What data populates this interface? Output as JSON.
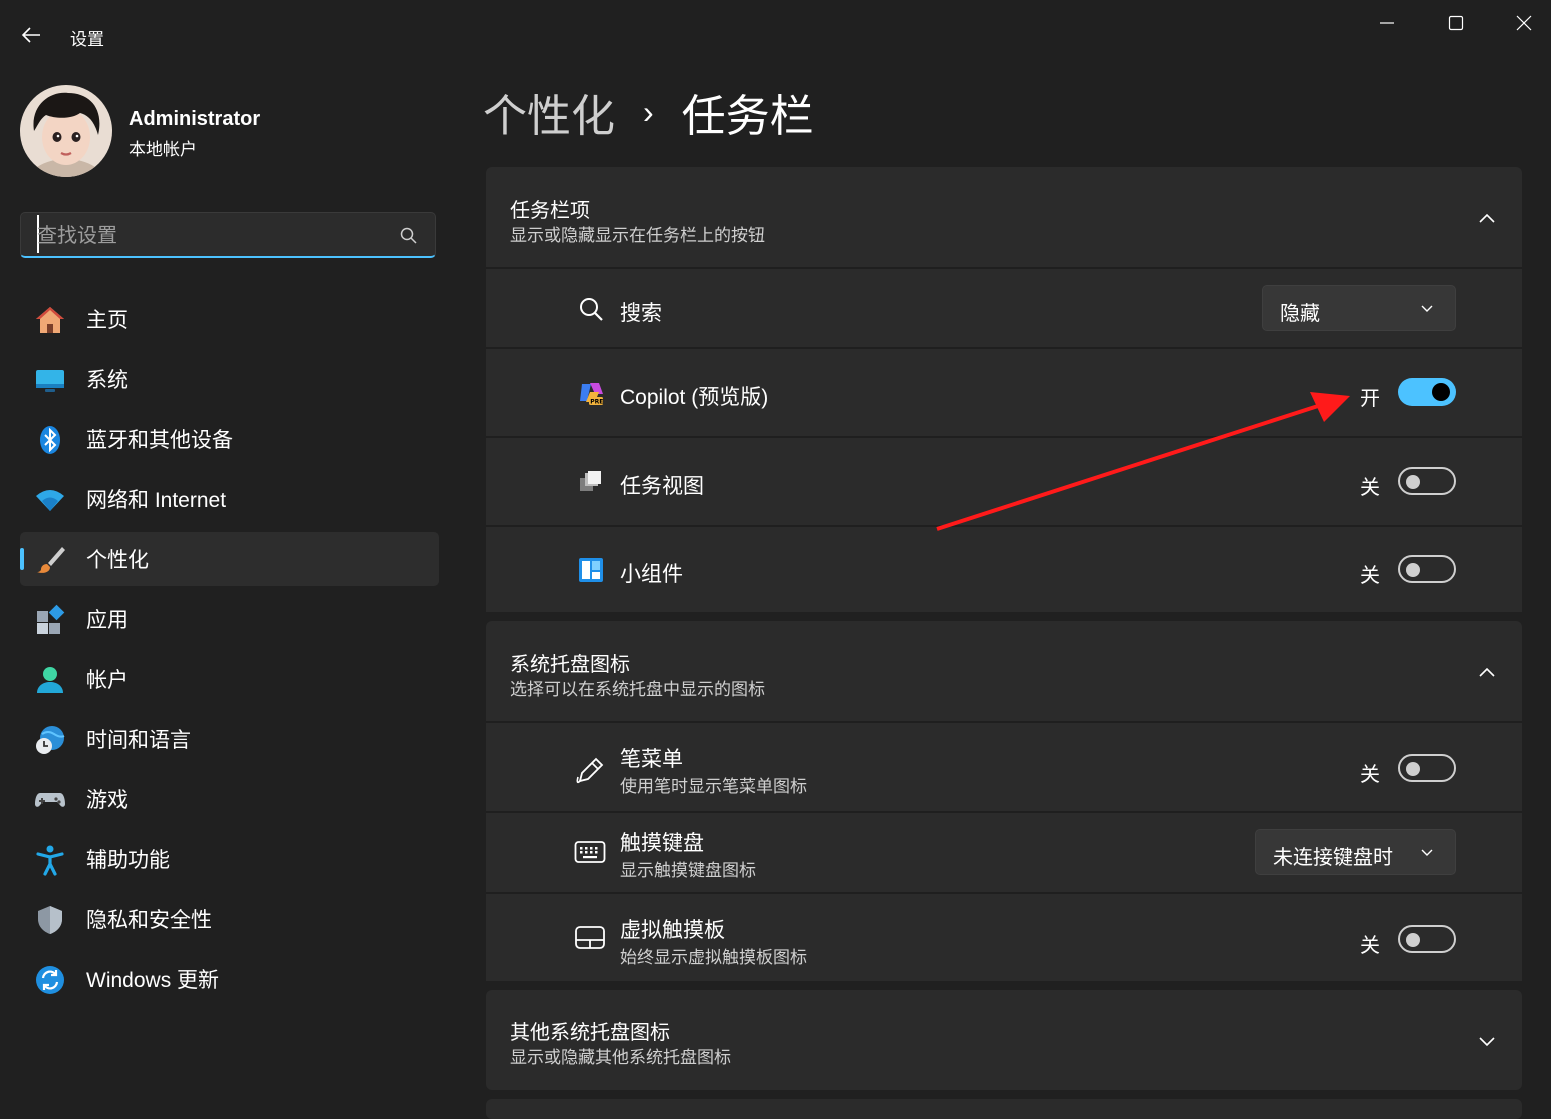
{
  "window": {
    "title": "设置",
    "controls": [
      "minimize",
      "maximize",
      "close"
    ]
  },
  "profile": {
    "name": "Administrator",
    "account_type": "本地帐户"
  },
  "search": {
    "placeholder": "查找设置",
    "value": ""
  },
  "nav": {
    "items": [
      {
        "label": "主页",
        "icon": "home-icon",
        "active": false
      },
      {
        "label": "系统",
        "icon": "monitor-icon",
        "active": false
      },
      {
        "label": "蓝牙和其他设备",
        "icon": "bluetooth-icon",
        "active": false
      },
      {
        "label": "网络和 Internet",
        "icon": "wifi-icon",
        "active": false
      },
      {
        "label": "个性化",
        "icon": "paintbrush-icon",
        "active": true
      },
      {
        "label": "应用",
        "icon": "apps-icon",
        "active": false
      },
      {
        "label": "帐户",
        "icon": "person-icon",
        "active": false
      },
      {
        "label": "时间和语言",
        "icon": "globe-clock-icon",
        "active": false
      },
      {
        "label": "游戏",
        "icon": "gamepad-icon",
        "active": false
      },
      {
        "label": "辅助功能",
        "icon": "accessibility-icon",
        "active": false
      },
      {
        "label": "隐私和安全性",
        "icon": "shield-icon",
        "active": false
      },
      {
        "label": "Windows 更新",
        "icon": "sync-icon",
        "active": false
      }
    ]
  },
  "breadcrumb": {
    "parent": "个性化",
    "separator": "›",
    "current": "任务栏"
  },
  "groups": {
    "taskbar_items": {
      "title": "任务栏项",
      "subtitle": "显示或隐藏显示在任务栏上的按钮",
      "expanded": true,
      "rows": {
        "search": {
          "label": "搜索",
          "icon": "search-icon",
          "dropdown_value": "隐藏"
        },
        "copilot": {
          "label": "Copilot (预览版)",
          "icon": "copilot-icon",
          "state": "开",
          "on": true
        },
        "task_view": {
          "label": "任务视图",
          "icon": "task-view-icon",
          "state": "关",
          "on": false
        },
        "widgets": {
          "label": "小组件",
          "icon": "widgets-icon",
          "state": "关",
          "on": false
        }
      }
    },
    "system_tray": {
      "title": "系统托盘图标",
      "subtitle": "选择可以在系统托盘中显示的图标",
      "expanded": true,
      "rows": {
        "pen_menu": {
          "label": "笔菜单",
          "sub": "使用笔时显示笔菜单图标",
          "icon": "pen-icon",
          "state": "关",
          "on": false
        },
        "touch_keyboard": {
          "label": "触摸键盘",
          "sub": "显示触摸键盘图标",
          "icon": "keyboard-icon",
          "dropdown_value": "未连接键盘时"
        },
        "virtual_touchpad": {
          "label": "虚拟触摸板",
          "sub": "始终显示虚拟触摸板图标",
          "icon": "touchpad-icon",
          "state": "关",
          "on": false
        }
      }
    },
    "other_tray": {
      "title": "其他系统托盘图标",
      "subtitle": "显示或隐藏其他系统托盘图标",
      "expanded": false
    }
  },
  "colors": {
    "accent": "#4cc2ff",
    "background": "#202020",
    "card": "#2b2b2b",
    "annotation_arrow": "#ff1a1a"
  }
}
